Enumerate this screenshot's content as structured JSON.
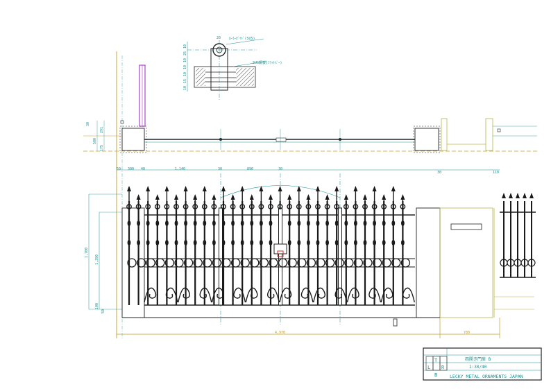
{
  "drawing": {
    "top_dims": [
      "30",
      "500",
      "291",
      "175"
    ],
    "detail_dims_top": "20",
    "detail_dims_left": [
      "10",
      "25",
      "10",
      "10",
      "10",
      "15",
      "10"
    ],
    "detail_note1": "ﾛｰﾗｰｶﾞｲﾄﾞ(SUS)",
    "detail_note2": "SUS鋼板(ﾌﾗｯﾄﾊﾞｰ)",
    "plan_dims": [
      "50",
      "300",
      "40",
      "1,140",
      "30",
      "896",
      "30",
      "30",
      "110"
    ],
    "height_dims": [
      "1,700",
      "1,390",
      "100",
      "50"
    ],
    "total_width": "4,970",
    "right_dim": "780"
  },
  "title_block": {
    "drawing_name": "両開き門扉 B",
    "scale": "1:30/40",
    "company": "LECKY METAL ORNAMENTS JAPAN",
    "grid_letters": [
      "L",
      "T",
      "R",
      "B"
    ]
  },
  "colors": {
    "ink": "#1a1a1a",
    "dim": "#1a8f8f",
    "ochre": "#c49a2a",
    "magenta": "#b040d0",
    "olive": "#b9b44a",
    "red": "#c0302a"
  }
}
